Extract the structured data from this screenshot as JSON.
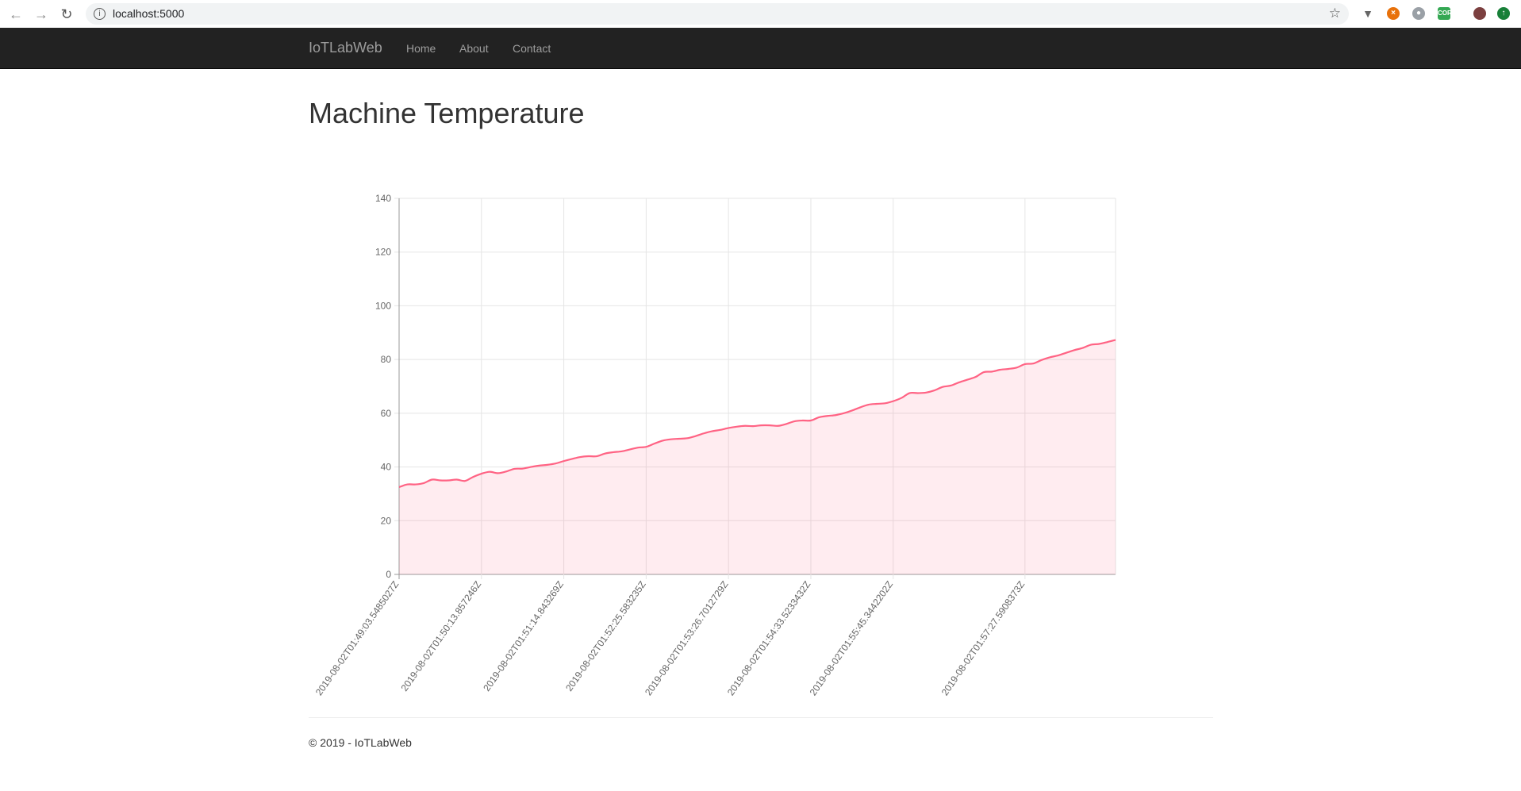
{
  "browser": {
    "url": "localhost:5000",
    "back_icon": "arrow-left-icon",
    "forward_icon": "arrow-right-icon",
    "reload_icon": "reload-icon",
    "star_icon": "star-icon"
  },
  "navbar": {
    "brand": "IoTLabWeb",
    "links": [
      "Home",
      "About",
      "Contact"
    ]
  },
  "page": {
    "title": "Machine Temperature"
  },
  "footer": {
    "text": "© 2019 - IoTLabWeb"
  },
  "colors": {
    "line": "#ff6384",
    "fill": "rgba(255,99,132,0.12)",
    "navbar_bg": "#222222"
  },
  "chart_data": {
    "type": "area",
    "ylim": [
      0,
      140
    ],
    "yticks": [
      0,
      20,
      40,
      60,
      80,
      100,
      120,
      140
    ],
    "grid": true,
    "x_tick_labels": [
      "2019-08-02T01:49:03.5485027Z",
      "2019-08-02T01:50:13.857246Z",
      "2019-08-02T01:51:14.843269Z",
      "2019-08-02T01:52:25.583235Z",
      "2019-08-02T01:53:26.7012729Z",
      "2019-08-02T01:54:33.5233432Z",
      "2019-08-02T01:55:45.3442202Z",
      "2019-08-02T01:57:27.5908373Z"
    ],
    "x_tick_index": [
      0,
      10,
      20,
      30,
      40,
      50,
      60,
      76
    ],
    "values": [
      32.5,
      33.5,
      33.5,
      34,
      35.3,
      35,
      35,
      35.3,
      34.8,
      36.3,
      37.5,
      38.2,
      37.7,
      38.3,
      39.3,
      39.4,
      40,
      40.5,
      40.8,
      41.3,
      42.2,
      43,
      43.7,
      44,
      44,
      45,
      45.5,
      45.8,
      46.5,
      47.2,
      47.5,
      48.7,
      49.8,
      50.3,
      50.5,
      50.7,
      51.5,
      52.5,
      53.3,
      53.8,
      54.5,
      55,
      55.3,
      55.2,
      55.5,
      55.5,
      55.3,
      56,
      57,
      57.3,
      57.3,
      58.5,
      59,
      59.3,
      60,
      61,
      62.2,
      63.2,
      63.5,
      63.7,
      64.5,
      65.7,
      67.5,
      67.5,
      67.7,
      68.5,
      69.8,
      70.3,
      71.5,
      72.5,
      73.5,
      75.3,
      75.5,
      76.2,
      76.5,
      77,
      78.3,
      78.5,
      79.8,
      80.8,
      81.5,
      82.5,
      83.5,
      84.3,
      85.5,
      85.8,
      86.5,
      87.3
    ]
  }
}
